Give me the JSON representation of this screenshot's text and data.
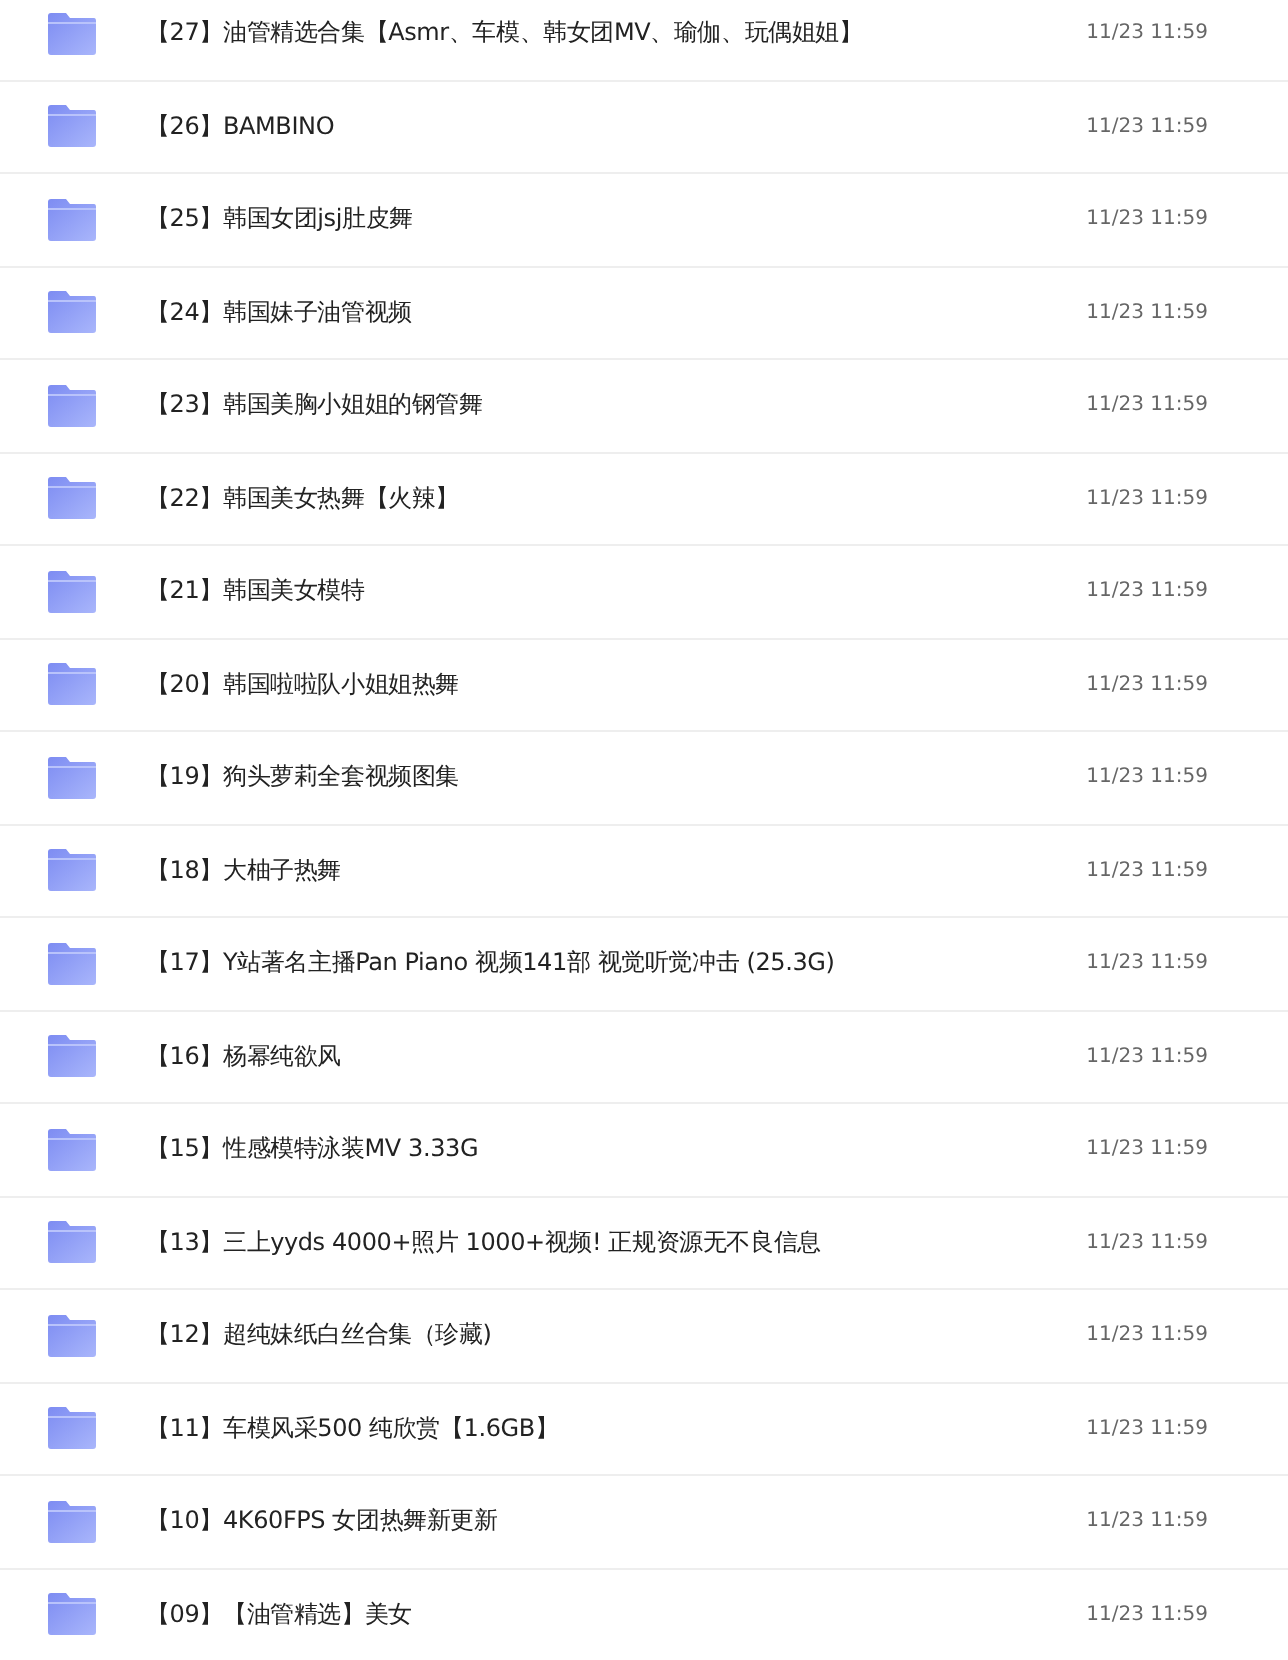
{
  "files": [
    {
      "name": "【27】油管精选合集【Asmr、车模、韩女团MV、瑜伽、玩偶姐姐】",
      "time": "11/23 11:59"
    },
    {
      "name": "【26】BAMBINO",
      "time": "11/23 11:59"
    },
    {
      "name": "【25】韩国女团jsj肚皮舞",
      "time": "11/23 11:59"
    },
    {
      "name": "【24】韩国妹子油管视频",
      "time": "11/23 11:59"
    },
    {
      "name": "【23】韩国美胸小姐姐的钢管舞",
      "time": "11/23 11:59"
    },
    {
      "name": "【22】韩国美女热舞【火辣】",
      "time": "11/23 11:59"
    },
    {
      "name": "【21】韩国美女模特",
      "time": "11/23 11:59"
    },
    {
      "name": "【20】韩国啦啦队小姐姐热舞",
      "time": "11/23 11:59"
    },
    {
      "name": "【19】狗头萝莉全套视频图集",
      "time": "11/23 11:59"
    },
    {
      "name": "【18】大柚子热舞",
      "time": "11/23 11:59"
    },
    {
      "name": "【17】Y站著名主播Pan Piano 视频141部 视觉听觉冲击 (25.3G)",
      "time": "11/23 11:59"
    },
    {
      "name": "【16】杨幂纯欲风",
      "time": "11/23 11:59"
    },
    {
      "name": "【15】性感模特泳装MV 3.33G",
      "time": "11/23 11:59"
    },
    {
      "name": "【13】三上yyds 4000+照片 1000+视频! 正规资源无不良信息",
      "time": "11/23 11:59"
    },
    {
      "name": "【12】超纯妹纸白丝合集（珍藏)",
      "time": "11/23 11:59"
    },
    {
      "name": "【11】车模风采500 纯欣赏【1.6GB】",
      "time": "11/23 11:59"
    },
    {
      "name": "【10】4K60FPS 女团热舞新更新",
      "time": "11/23 11:59"
    },
    {
      "name": "【09】【油管精选】美女",
      "time": "11/23 11:59"
    }
  ]
}
